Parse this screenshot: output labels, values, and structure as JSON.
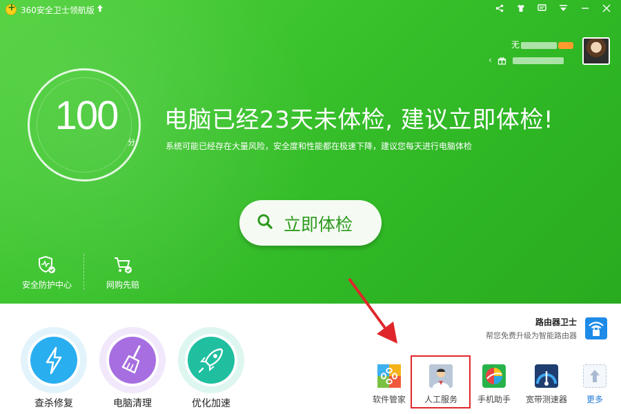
{
  "window": {
    "title": "360安全卫士领航版",
    "upgrade_icon": "up-arrow-icon",
    "buttons": [
      "share-icon",
      "shirt-icon",
      "message-icon",
      "menu-icon",
      "minimize-icon",
      "close-icon"
    ]
  },
  "user": {
    "name_prefix": "无",
    "avatar": "user-avatar"
  },
  "score": {
    "value": "100",
    "unit": "分"
  },
  "headline": "电脑已经23天未体检, 建议立即体检!",
  "subline": "系统可能已经存在大量风险，安全度和性能都在极速下降，建议您每天进行电脑体检",
  "check_button": "立即体检",
  "quick_actions": [
    {
      "label": "安全防护中心",
      "icon": "shield-check-icon"
    },
    {
      "label": "网购先赔",
      "icon": "cart-check-icon"
    }
  ],
  "router": {
    "title": "路由器卫士",
    "subtitle": "帮您免费升级为智能路由器",
    "icon": "wifi-lock-icon"
  },
  "main_features": [
    {
      "label": "查杀修复",
      "icon": "lightning-icon",
      "color": "#29aef0"
    },
    {
      "label": "电脑清理",
      "icon": "broom-icon",
      "color": "#a66ee0"
    },
    {
      "label": "优化加速",
      "icon": "rocket-icon",
      "color": "#1fbfa0"
    }
  ],
  "tools": [
    {
      "label": "软件管家",
      "icon": "software-manager-icon"
    },
    {
      "label": "人工服务",
      "icon": "doctor-icon"
    },
    {
      "label": "手机助手",
      "icon": "phone-helper-icon"
    },
    {
      "label": "宽带测速器",
      "icon": "speedometer-icon"
    },
    {
      "label": "更多",
      "icon": "more-arrow-icon"
    }
  ],
  "colors": {
    "top_green": "#3cc42e",
    "button_text": "#2d9a1d",
    "highlight_red": "#e0262b",
    "more_blue": "#1e7ad8"
  }
}
